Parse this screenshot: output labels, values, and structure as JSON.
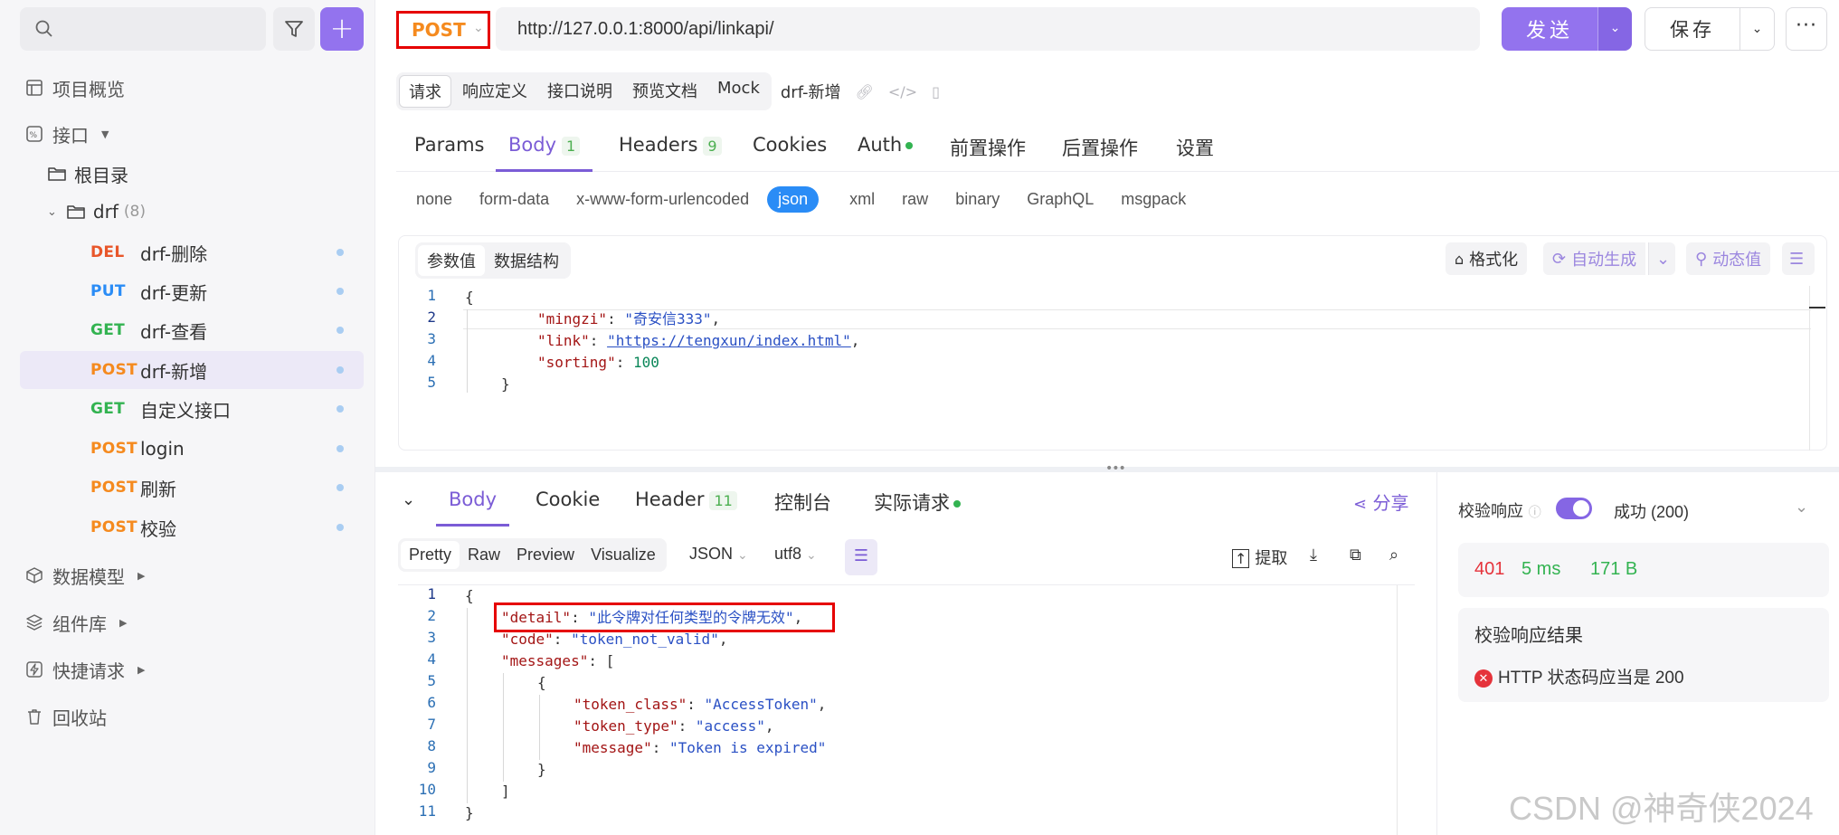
{
  "sidebar": {
    "search": {
      "placeholder": ""
    },
    "nav": {
      "overview": "项目概览",
      "api": "接口",
      "data_models": "数据模型",
      "components": "组件库",
      "quick_request": "快捷请求",
      "recycle": "回收站"
    },
    "tree": {
      "root": "根目录",
      "folder_name": "drf",
      "folder_count": "(8)"
    },
    "apis": [
      {
        "method": "DEL",
        "name": "drf-删除",
        "color": "#e8562a"
      },
      {
        "method": "PUT",
        "name": "drf-更新",
        "color": "#2a8cf6"
      },
      {
        "method": "GET",
        "name": "drf-查看",
        "color": "#33b351"
      },
      {
        "method": "POST",
        "name": "drf-新增",
        "color": "#f58a1e"
      },
      {
        "method": "GET",
        "name": "自定义接口",
        "color": "#33b351"
      },
      {
        "method": "POST",
        "name": "login",
        "color": "#f58a1e"
      },
      {
        "method": "POST",
        "name": "刷新",
        "color": "#f58a1e"
      },
      {
        "method": "POST",
        "name": "校验",
        "color": "#f58a1e"
      }
    ]
  },
  "toolbar": {
    "method": "POST",
    "url": "http://127.0.0.1:8000/api/linkapi/",
    "send": "发送",
    "save": "保存"
  },
  "sub_tabs": {
    "items": [
      "请求",
      "响应定义",
      "接口说明",
      "预览文档",
      "Mock"
    ],
    "title": "drf-新增"
  },
  "request_tabs": {
    "params": "Params",
    "body": "Body",
    "body_count": "1",
    "headers": "Headers",
    "headers_count": "9",
    "cookies": "Cookies",
    "auth": "Auth",
    "pre": "前置操作",
    "post": "后置操作",
    "settings": "设置"
  },
  "body_types": [
    "none",
    "form-data",
    "x-www-form-urlencoded",
    "json",
    "xml",
    "raw",
    "binary",
    "GraphQL",
    "msgpack"
  ],
  "param_tabs": {
    "values": "参数值",
    "schema": "数据结构"
  },
  "editor_tools": {
    "format": "格式化",
    "auto": "自动生成",
    "dynamic": "动态值"
  },
  "request_body": {
    "lines": [
      "1",
      "2",
      "3",
      "4",
      "5"
    ],
    "open": "{",
    "k1": "\"mingzi\"",
    "v1": "\"奇安信333\"",
    "k2": "\"link\"",
    "v2": "\"https://tengxun/index.html\"",
    "k3": "\"sorting\"",
    "v3": "100",
    "close": "}"
  },
  "response_tabs": {
    "body": "Body",
    "cookie": "Cookie",
    "header": "Header",
    "header_count": "11",
    "console": "控制台",
    "actual": "实际请求",
    "share": "分享"
  },
  "response_format": {
    "tabs": [
      "Pretty",
      "Raw",
      "Preview",
      "Visualize"
    ],
    "type": "JSON",
    "encoding": "utf8",
    "extract": "提取"
  },
  "response_body": {
    "lines": [
      "1",
      "2",
      "3",
      "4",
      "5",
      "6",
      "7",
      "8",
      "9",
      "10",
      "11"
    ],
    "detail_key": "\"detail\"",
    "detail_val": "\"此令牌对任何类型的令牌无效\"",
    "code_key": "\"code\"",
    "code_val": "\"token_not_valid\"",
    "messages_key": "\"messages\"",
    "tc_key": "\"token_class\"",
    "tc_val": "\"AccessToken\"",
    "tt_key": "\"token_type\"",
    "tt_val": "\"access\"",
    "msg_key": "\"message\"",
    "msg_val": "\"Token is expired\""
  },
  "validation": {
    "label": "校验响应",
    "status_choice": "成功 (200)",
    "status": "401",
    "time": "5 ms",
    "size": "171 B",
    "result_title": "校验响应结果",
    "result_msg": "HTTP 状态码应当是 200"
  },
  "watermark": "CSDN @神奇侠2024"
}
